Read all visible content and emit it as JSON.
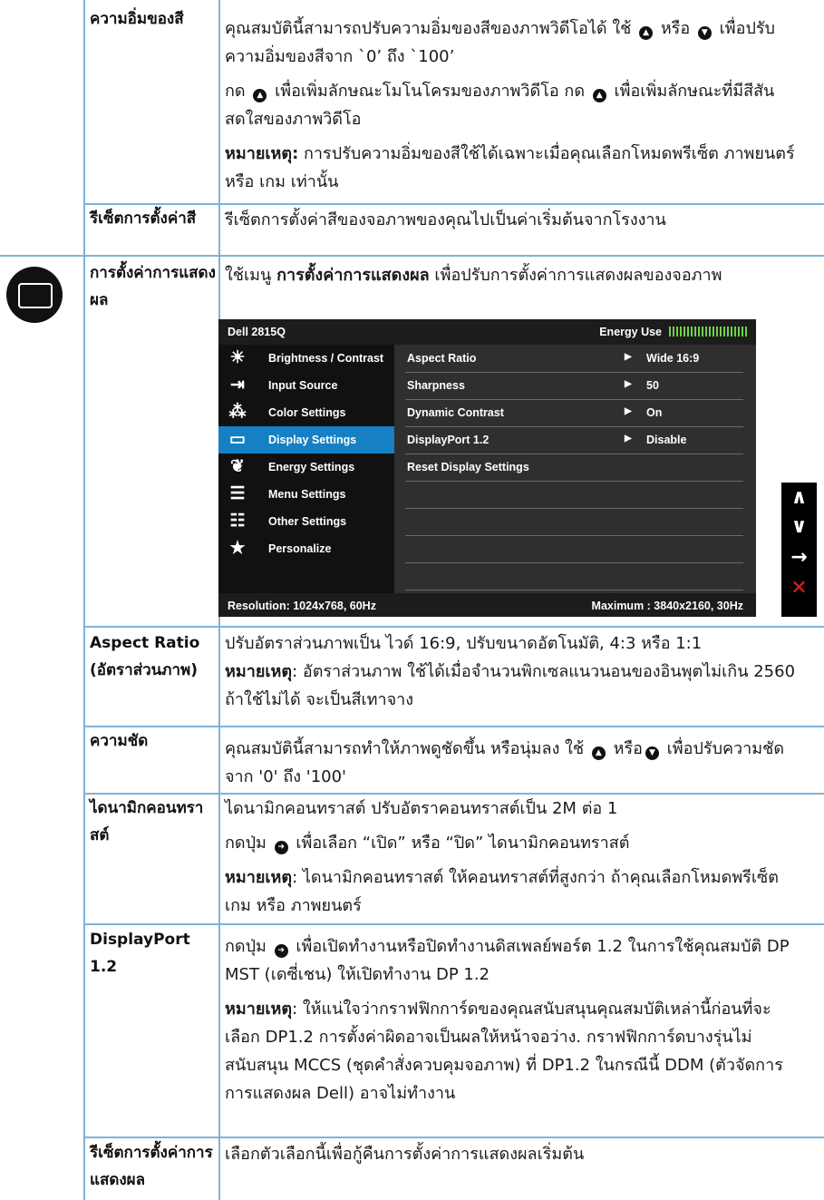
{
  "rows": {
    "saturation": {
      "label": "ความอิ่มของสี",
      "p1a": "คุณสมบัตินี้สามารถปรับความอิ่มของสีของภาพวิดีโอได้ ใช้",
      "p1b": "หรือ",
      "p1c": "เพื่อปรับความอิ่มของสีจาก `0’ ถึง `100’",
      "p2a": "กด",
      "p2b": "เพื่อเพิ่มลักษณะโมโนโครมของภาพวิดีโอ กด",
      "p2c": "เพื่อเพิ่มลักษณะที่มีสีสันสดใสของภาพวิดีโอ",
      "note_label": "หมายเหตุ:",
      "note": "การปรับความอิ่มของสีใช้ได้เฉพาะเมื่อคุณเลือกโหมดพรีเซ็ต ภาพยนตร์ หรือ เกม เท่านั้น"
    },
    "reset_color": {
      "label": "รีเซ็ตการตั้งค่าสี",
      "text": "รีเซ็ตการตั้งค่าสีของจอภาพของคุณไปเป็นค่าเริ่มต้นจากโรงงาน"
    },
    "display_settings": {
      "label": "การตั้งค่าการแสดงผล",
      "text_a": "ใช้เมนู",
      "text_b": "การตั้งค่าการแสดงผล",
      "text_c": "เพื่อปรับการตั้งค่าการแสดงผลของจอภาพ"
    },
    "aspect": {
      "label": "Aspect Ratio (อัตราส่วนภาพ)",
      "text": "ปรับอัตราส่วนภาพเป็น ไวด์ 16:9, ปรับขนาดอัตโนมัติ, 4:3 หรือ 1:1",
      "note_label": "หมายเหตุ",
      "note": ": อัตราส่วนภาพ ใช้ได้เมื่อจำนวนพิกเซลแนวนอนของอินพุตไม่เกิน 2560 ถ้าใช้ไม่ได้ จะเป็นสีเทาจาง"
    },
    "sharpness": {
      "label": "ความชัด",
      "text_a": "คุณสมบัตินี้สามารถทำให้ภาพดูชัดขึ้น หรือนุ่มลง ใช้",
      "text_b": "หรือ",
      "text_c": "เพื่อปรับความชัดจาก '0' ถึง '100'"
    },
    "dynamic": {
      "label": "ไดนามิกคอนทราสต์",
      "p1": "ไดนามิกคอนทราสต์ ปรับอัตราคอนทราสต์เป็น 2M ต่อ 1",
      "p2a": "กดปุ่ม",
      "p2b": "เพื่อเลือก “เปิด” หรือ “ปิด” ไดนามิกคอนทราสต์",
      "note_label": "หมายเหตุ",
      "note": ": ไดนามิกคอนทราสต์ ให้คอนทราสต์ที่สูงกว่า ถ้าคุณเลือกโหมดพรีเซ็ต เกม หรือ ภาพยนตร์"
    },
    "dp12": {
      "label": "DisplayPort 1.2",
      "p1a": "กดปุ่ม",
      "p1b": "เพื่อเปิดทำงานหรือปิดทำงานดิสเพลย์พอร์ต 1.2 ในการใช้คุณสมบัติ DP MST (เดซี่เชน) ให้เปิดทำงาน DP 1.2",
      "note_label": "หมายเหตุ",
      "note": ": ให้แน่ใจว่ากราฟฟิกการ์ดของคุณสนับสนุนคุณสมบัติเหล่านี้ก่อนที่จะเลือก DP1.2 การตั้งค่าผิดอาจเป็นผลให้หน้าจอว่าง. กราฟฟิกการ์ดบางรุ่นไม่สนับสนุน MCCS (ชุดคำสั่งควบคุมจอภาพ) ที่ DP1.2 ในกรณีนี้ DDM (ตัวจัดการการแสดงผล Dell) อาจไม่ทำงาน"
    },
    "reset_display": {
      "label": "รีเซ็ตการตั้งค่าการแสดงผล",
      "text": "เลือกตัวเลือกนี้เพื่อกู้คืนการตั้งค่าการแสดงผลเริ่มต้น"
    }
  },
  "osd": {
    "model": "Dell 2815Q",
    "energy_label": "Energy Use",
    "menu": [
      {
        "icon": "☀",
        "label": "Brightness / Contrast"
      },
      {
        "icon": "⇥",
        "label": "Input Source"
      },
      {
        "icon": "⁂",
        "label": "Color Settings"
      },
      {
        "icon": "▭",
        "label": "Display Settings"
      },
      {
        "icon": "❦",
        "label": "Energy Settings"
      },
      {
        "icon": "☰",
        "label": "Menu Settings"
      },
      {
        "icon": "☷",
        "label": "Other Settings"
      },
      {
        "icon": "★",
        "label": "Personalize"
      }
    ],
    "submenu": [
      {
        "label": "Aspect Ratio",
        "value": "Wide 16:9"
      },
      {
        "label": "Sharpness",
        "value": "50"
      },
      {
        "label": "Dynamic Contrast",
        "value": "On"
      },
      {
        "label": "DisplayPort 1.2",
        "value": "Disable"
      },
      {
        "label": "Reset Display Settings",
        "value": ""
      }
    ],
    "resolution": "Resolution: 1024x768,  60Hz",
    "maximum": "Maximum : 3840x2160,  30Hz"
  },
  "side_buttons": [
    "∧",
    "∨",
    "→",
    "✕"
  ],
  "colors": {
    "border": "#7fb2d9",
    "osd_select": "#1580c3",
    "close": "#e02020"
  }
}
